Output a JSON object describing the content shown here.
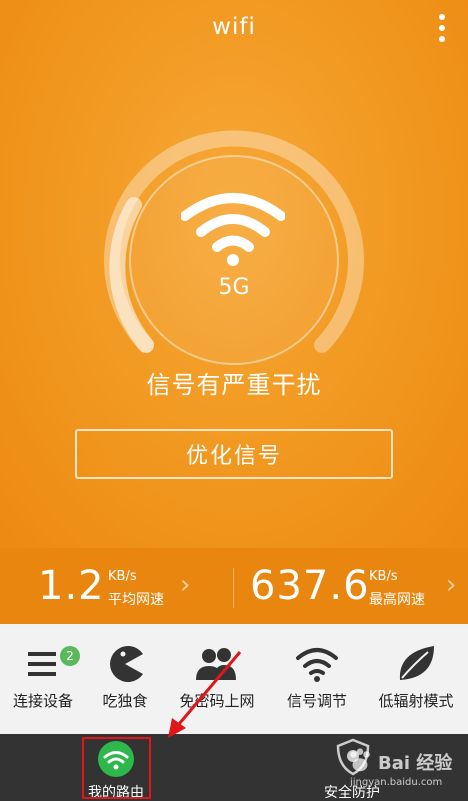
{
  "header": {
    "title": "wifi",
    "menu_icon": "more-vertical-icon"
  },
  "gauge": {
    "band": "5G",
    "icon": "wifi-icon",
    "status": "信号有严重干扰"
  },
  "optimize_button": {
    "label": "优化信号"
  },
  "speeds": [
    {
      "value": "1.2",
      "unit": "KB/s",
      "label": "平均网速"
    },
    {
      "value": "637.6",
      "unit": "KB/s",
      "label": "最高网速"
    }
  ],
  "tools": [
    {
      "label": "连接设备",
      "icon": "devices-list-icon",
      "badge": "2"
    },
    {
      "label": "吃独食",
      "icon": "pacman-icon"
    },
    {
      "label": "免密码上网",
      "icon": "users-icon"
    },
    {
      "label": "信号调节",
      "icon": "wifi-signal-icon"
    },
    {
      "label": "低辐射模式",
      "icon": "leaf-icon"
    }
  ],
  "bottom_nav": [
    {
      "label": "我的路由",
      "icon": "wifi-router-icon",
      "active": true
    },
    {
      "label": "安全防护",
      "icon": "shield-icon"
    }
  ],
  "watermark": {
    "main": "Bai 经验",
    "sub": "jingyan.baidu.com"
  },
  "colors": {
    "accent": "#f29a22",
    "nav_bg": "#333333",
    "active_green": "#2eb84b",
    "highlight_red": "#e0161b"
  }
}
